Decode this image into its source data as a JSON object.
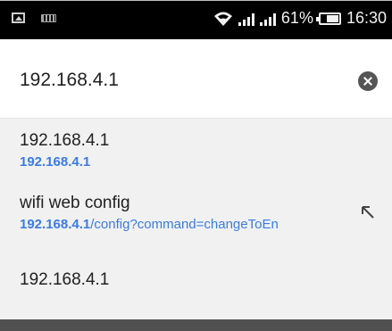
{
  "status_bar": {
    "battery": "61%",
    "time": "16:30",
    "icons": [
      "image-notification-icon",
      "keyboard-icon",
      "wifi-icon",
      "signal-icon",
      "signal-icon",
      "battery-icon"
    ]
  },
  "address_bar": {
    "value": "192.168.4.1",
    "clear_icon": "clear-icon"
  },
  "suggestions": [
    {
      "title": "192.168.4.1",
      "url_bold": "192.168.4.1",
      "url_rest": ""
    },
    {
      "title": "wifi web config",
      "url_bold": "192.168.4.1",
      "url_rest": "/config?command=changeToEn",
      "action_icon": "fill-arrow-icon"
    },
    {
      "title": "192.168.4.1"
    }
  ],
  "colors": {
    "status_bar_bg": "#000000",
    "suggestion_bg": "#f1f1f1",
    "link": "#3b7be3",
    "bottom_bar": "#505050"
  }
}
